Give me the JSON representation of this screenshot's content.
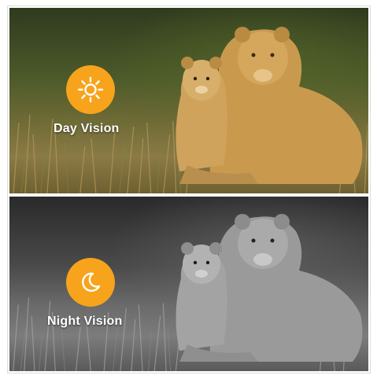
{
  "day": {
    "label": "Day Vision",
    "icon": "sun-icon",
    "badge_color": "#f7a31c"
  },
  "night": {
    "label": "Night Vision",
    "icon": "moon-icon",
    "badge_color": "#f7a31c"
  }
}
